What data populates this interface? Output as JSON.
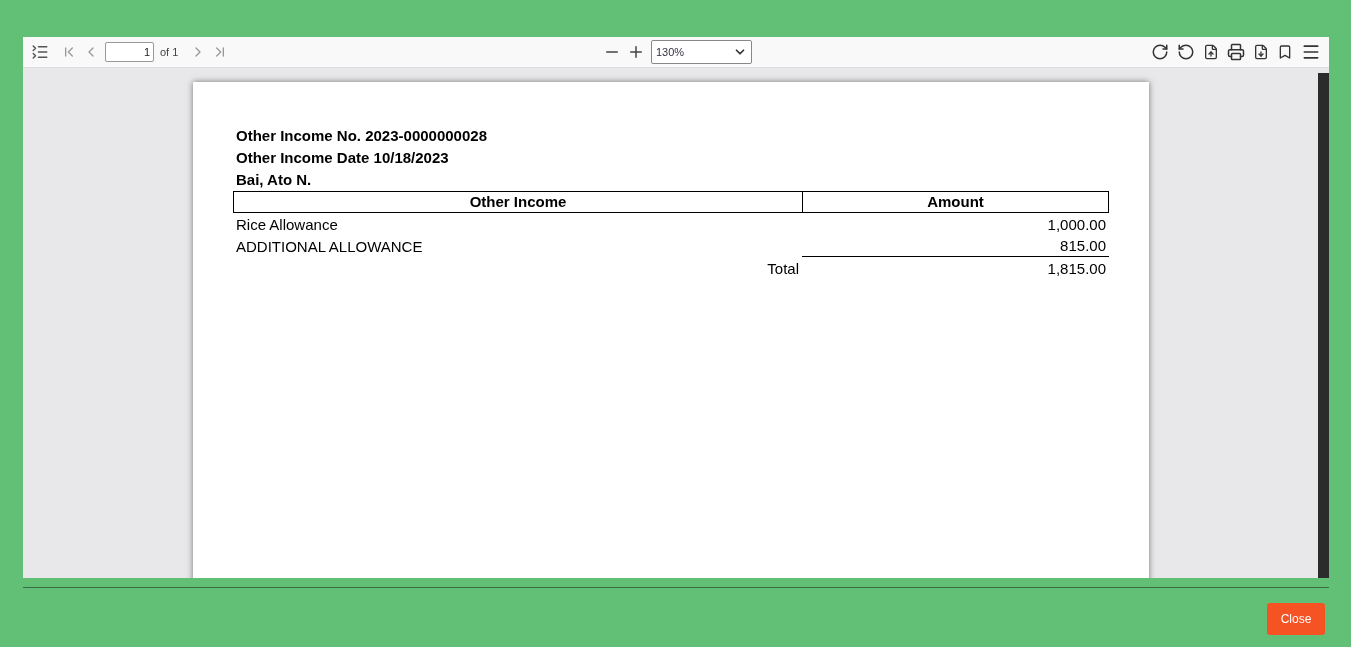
{
  "toolbar": {
    "page_input": "1",
    "page_count": "of 1",
    "zoom": "130%"
  },
  "document": {
    "heading_lines": [
      "Other Income No. 2023-0000000028",
      "Other Income Date 10/18/2023",
      "Bai, Ato N."
    ],
    "table": {
      "columns": [
        "Other Income",
        "Amount"
      ],
      "rows": [
        {
          "item": "Rice Allowance",
          "amount": "1,000.00"
        },
        {
          "item": "ADDITIONAL ALLOWANCE",
          "amount": "815.00"
        }
      ],
      "total_label": "Total",
      "total_value": "1,815.00"
    }
  },
  "footer": {
    "close_button": "Close"
  }
}
